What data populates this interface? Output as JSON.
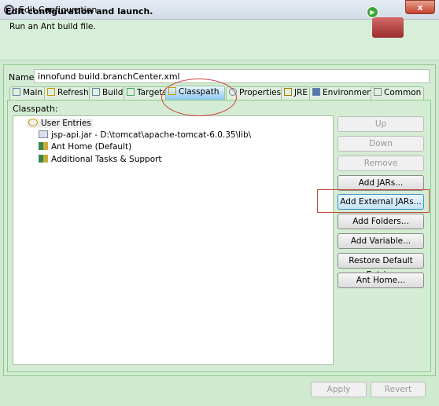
{
  "window": {
    "title": "Edit Configuration",
    "close": "x"
  },
  "header": {
    "title": "Edit configuration and launch.",
    "subtitle": "Run an Ant build file."
  },
  "name": {
    "label": "Name:",
    "value": "innofund build.branchCenter.xml"
  },
  "tabs": [
    {
      "label": "Main"
    },
    {
      "label": "Refresh"
    },
    {
      "label": "Build"
    },
    {
      "label": "Targets"
    },
    {
      "label": "Classpath",
      "active": true
    },
    {
      "label": "Properties"
    },
    {
      "label": "JRE"
    },
    {
      "label": "Environment"
    },
    {
      "label": "Common"
    }
  ],
  "classpath": {
    "label": "Classpath:",
    "tree": [
      {
        "label": "User Entries",
        "icon": "classpath-icon"
      },
      {
        "label": "jsp-api.jar - D:\\tomcat\\apache-tomcat-6.0.35\\lib\\",
        "icon": "jar-icon"
      },
      {
        "label": "Ant Home (Default)",
        "icon": "library-icon"
      },
      {
        "label": "Additional Tasks & Support",
        "icon": "library-icon"
      }
    ]
  },
  "buttons": [
    {
      "label": "Up",
      "enabled": false
    },
    {
      "label": "Down",
      "enabled": false
    },
    {
      "label": "Remove",
      "enabled": false
    },
    {
      "label": "Add JARs...",
      "enabled": true
    },
    {
      "label": "Add External JARs...",
      "enabled": true,
      "highlighted": true
    },
    {
      "label": "Add Folders...",
      "enabled": true
    },
    {
      "label": "Add Variable...",
      "enabled": true
    },
    {
      "label": "Restore Default Entries",
      "enabled": true
    },
    {
      "label": "Ant Home...",
      "enabled": true
    }
  ],
  "footer": {
    "apply": "Apply",
    "revert": "Revert"
  },
  "annotation_color": "#d04040"
}
